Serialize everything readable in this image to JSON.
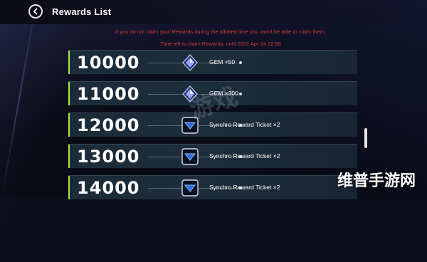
{
  "header": {
    "title": "Rewards List"
  },
  "notice": {
    "line1": "If you do not claim your Rewards during the allotted time you won't be able to claim them.",
    "line2": "Time left to claim Rewards: until 2022 Apr 24 22:59"
  },
  "rewards": [
    {
      "amount": "10000",
      "label": "GEM ×50",
      "icon": "gem-icon"
    },
    {
      "amount": "11000",
      "label": "GEM ×300",
      "icon": "gem-icon"
    },
    {
      "amount": "12000",
      "label": "Synchro Reward Ticket ×2",
      "icon": "ticket-icon"
    },
    {
      "amount": "13000",
      "label": "Synchro Reward Ticket ×2",
      "icon": "ticket-icon"
    },
    {
      "amount": "14000",
      "label": "Synchro Reward Ticket ×2",
      "icon": "ticket-icon"
    }
  ],
  "colors": {
    "accent": "#a6e84a",
    "notice": "#d23a3a",
    "row_bg": "#1e303e"
  },
  "watermark": {
    "brand": "维普手游网",
    "center": "游戏"
  }
}
